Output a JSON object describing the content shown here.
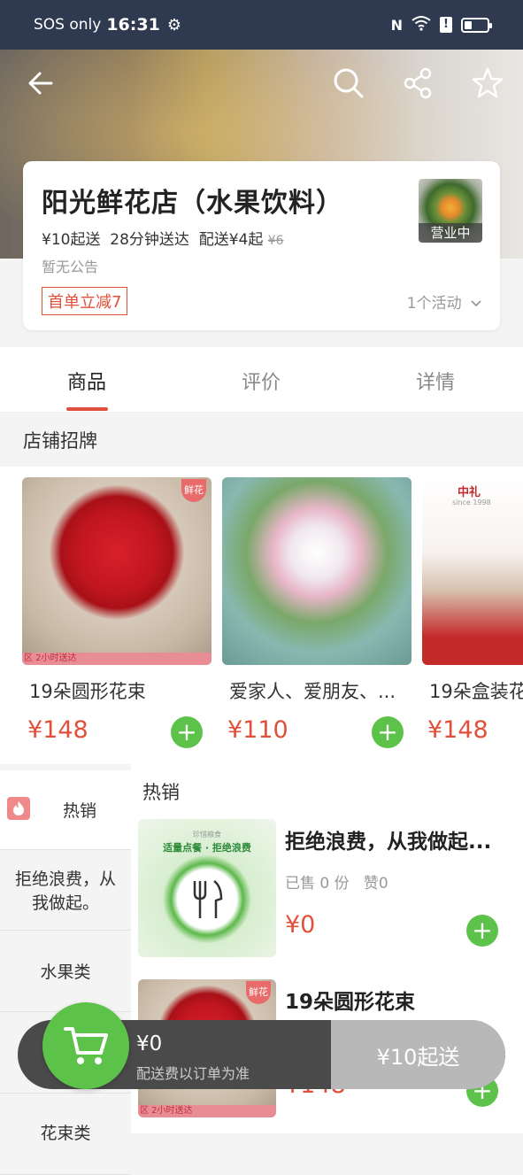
{
  "status_bar": {
    "carrier": "SOS only",
    "time": "16:31"
  },
  "store": {
    "name": "阳光鲜花店（水果饮料）",
    "min_order": "¥10起送",
    "delivery_time": "28分钟送达",
    "delivery_fee": "配送¥4起",
    "original_fee": "¥6",
    "notice": "暂无公告",
    "promo": "首单立减7",
    "activities": "1个活动",
    "open_status": "营业中"
  },
  "tabs": [
    {
      "label": "商品"
    },
    {
      "label": "评价"
    },
    {
      "label": "详情"
    }
  ],
  "featured": {
    "title": "店铺招牌",
    "items": [
      {
        "name": "19朵圆形花束",
        "price": "¥148",
        "tag": "鲜花",
        "strip": "区 2小时送达"
      },
      {
        "name": "爱家人、爱朋友、...",
        "price": "¥110"
      },
      {
        "name": "19朵盒装花",
        "price": "¥148",
        "brand": "中礼",
        "since": "since 1998"
      }
    ]
  },
  "categories": [
    {
      "label": "热销"
    },
    {
      "label": "拒绝浪费，从我做起。"
    },
    {
      "label": "水果类"
    },
    {
      "label": ""
    },
    {
      "label": "花束类"
    }
  ],
  "list": {
    "title": "热销",
    "items": [
      {
        "name": "拒绝浪费，从我做起...",
        "sold": "已售 0 份",
        "likes": "赞0",
        "price": "¥0",
        "poster_top": "珍惜粮食",
        "poster_text": "适量点餐 · 拒绝浪费"
      },
      {
        "name": "19朵圆形花束",
        "price": "¥148",
        "tag": "鲜花",
        "strip": "区 2小时送达"
      }
    ]
  },
  "cart": {
    "amount": "¥0",
    "fee_note": "配送费以订单为准",
    "checkout": "¥10起送"
  },
  "colors": {
    "accent": "#e0503a",
    "green": "#5dc24a",
    "status_bar": "#2f3a50"
  }
}
